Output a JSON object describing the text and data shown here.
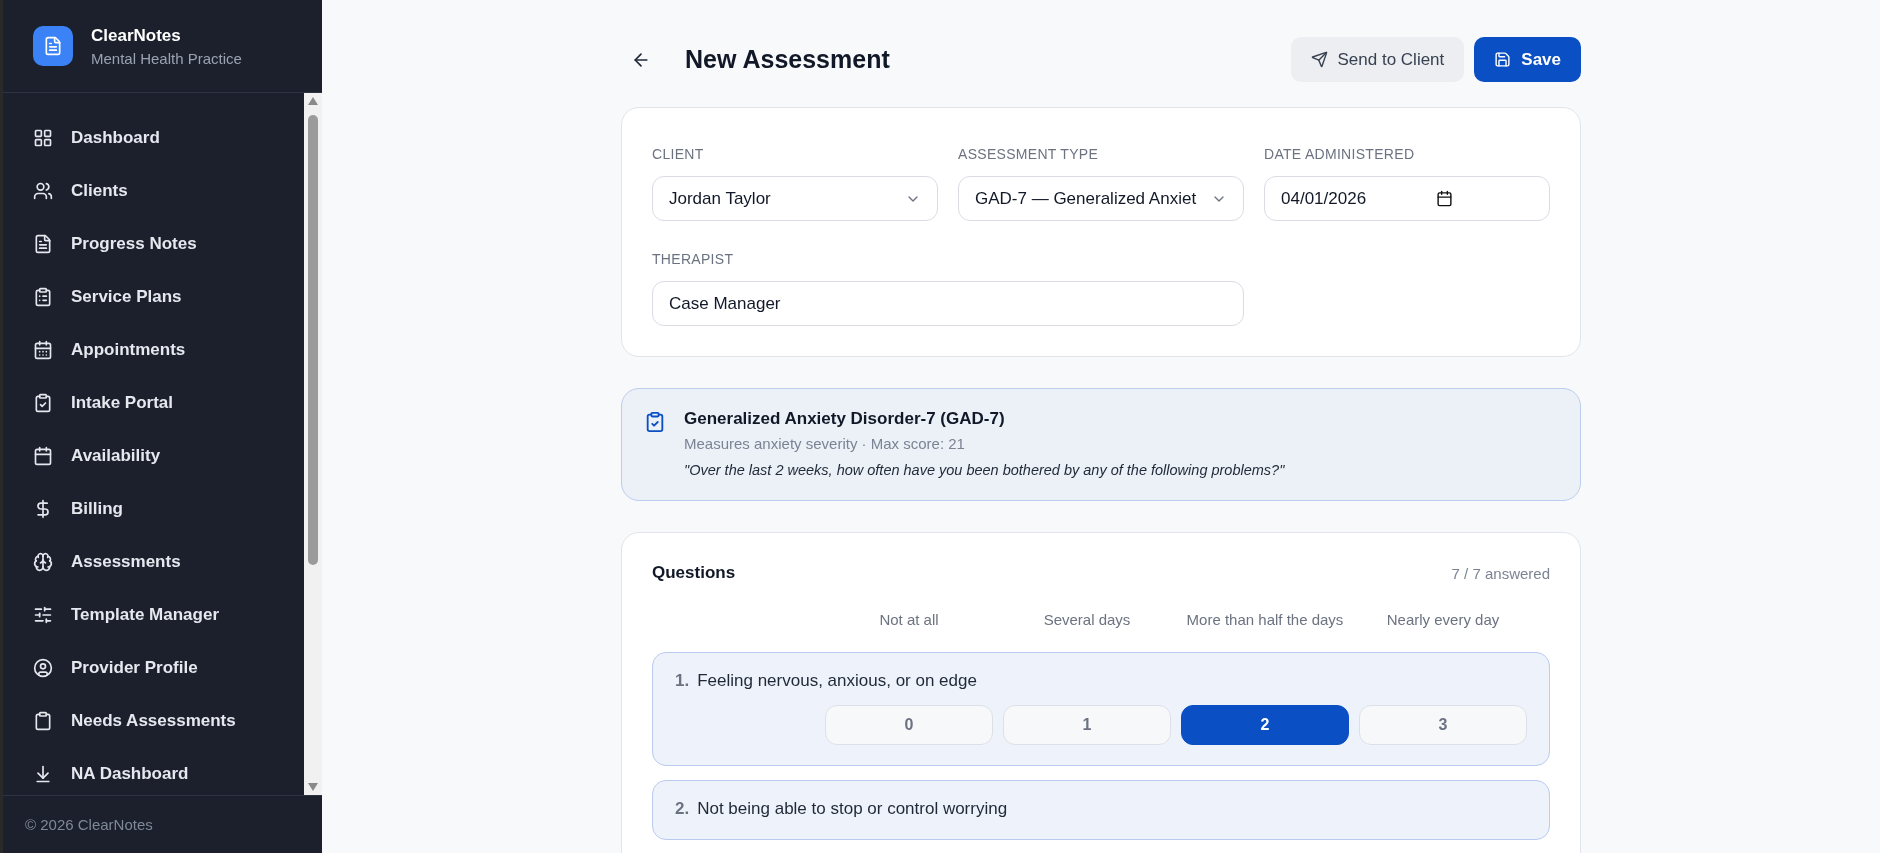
{
  "sidebar": {
    "brand": {
      "name": "ClearNotes",
      "subtitle": "Mental Health Practice"
    },
    "items": [
      {
        "label": "Dashboard"
      },
      {
        "label": "Clients"
      },
      {
        "label": "Progress Notes"
      },
      {
        "label": "Service Plans"
      },
      {
        "label": "Appointments"
      },
      {
        "label": "Intake Portal"
      },
      {
        "label": "Availability"
      },
      {
        "label": "Billing"
      },
      {
        "label": "Assessments"
      },
      {
        "label": "Template Manager"
      },
      {
        "label": "Provider Profile"
      },
      {
        "label": "Needs Assessments"
      },
      {
        "label": "NA Dashboard"
      }
    ],
    "footer": "© 2026 ClearNotes"
  },
  "header": {
    "title": "New Assessment",
    "buttons": [
      {
        "label": "Send to Client",
        "kind": "secondary"
      },
      {
        "label": "Save",
        "kind": "primary"
      }
    ]
  },
  "form": {
    "fields": [
      {
        "label": "CLIENT",
        "value": "Jordan Taylor",
        "kind": "select"
      },
      {
        "label": "ASSESSMENT TYPE",
        "value": "GAD-7 — Generalized Anxiet",
        "kind": "select"
      },
      {
        "label": "DATE ADMINISTERED",
        "value": "04/01/2026",
        "kind": "date"
      },
      {
        "label": "THERAPIST",
        "value": "Case Manager",
        "kind": "text"
      }
    ]
  },
  "info": {
    "title": "Generalized Anxiety Disorder-7 (GAD-7)",
    "subtitle": "Measures anxiety severity · Max score: 21",
    "prompt": "\"Over the last 2 weeks, how often have you been bothered by any of the following problems?\""
  },
  "questions": {
    "title": "Questions",
    "count": "7 / 7 answered",
    "scale": [
      "Not at all",
      "Several days",
      "More than half the days",
      "Nearly every day"
    ],
    "items": [
      {
        "number": "1.",
        "text": "Feeling nervous, anxious, or on edge",
        "options": [
          {
            "label": "0",
            "selected": false
          },
          {
            "label": "1",
            "selected": false
          },
          {
            "label": "2",
            "selected": true
          },
          {
            "label": "3",
            "selected": false
          }
        ]
      },
      {
        "number": "2.",
        "text": "Not being able to stop or control worrying"
      }
    ]
  }
}
